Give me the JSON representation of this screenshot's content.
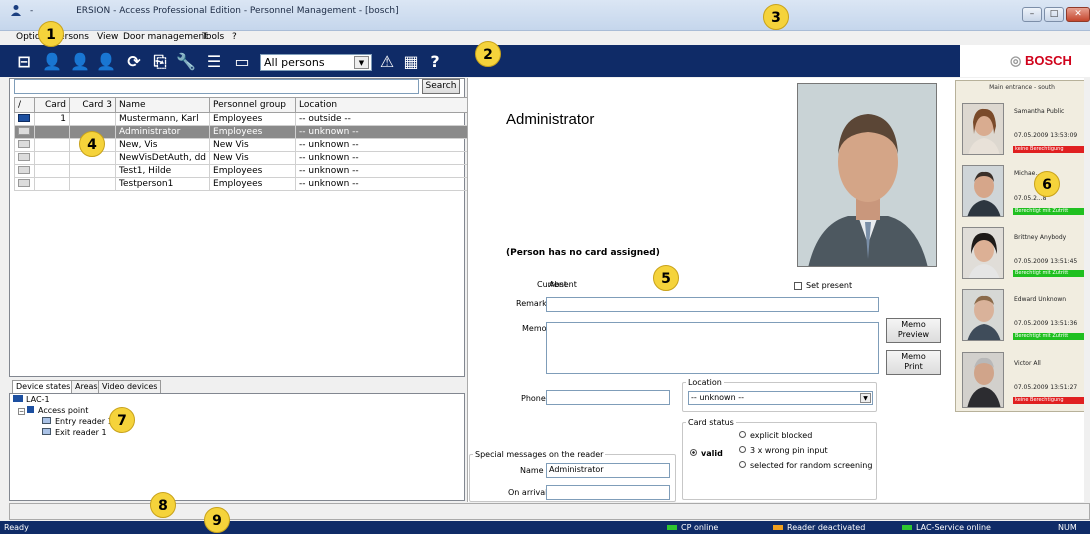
{
  "window": {
    "title": "- ",
    "title_partial": "ERSION - Access Professional Edition - Personnel Management - [bosch]",
    "buttons": {
      "minimize": "–",
      "maximize": "□",
      "close": "✕"
    }
  },
  "menu": {
    "items": [
      "Options",
      "Persons",
      "View",
      "Door management",
      "Tools",
      "?"
    ]
  },
  "toolbar": {
    "icons": [
      "card-reader-icon",
      "add-person-icon",
      "edit-person-icon",
      "delete-person-icon",
      "refresh-icon",
      "export-icon",
      "wrench-icon",
      "database-icon",
      "display-icon"
    ],
    "filter_value": "All persons",
    "right_icons": [
      "warning-icon",
      "grid-icon",
      "help-icon"
    ],
    "brand": "BOSCH"
  },
  "badges": [
    "1",
    "2",
    "3",
    "4",
    "5",
    "6",
    "7",
    "8",
    "9"
  ],
  "search": {
    "value": "",
    "button": "Search"
  },
  "table": {
    "headers": [
      "/",
      "Card",
      "Card 3",
      "Name",
      "Personnel group",
      "Location"
    ],
    "rows": [
      {
        "icon": "card-blue",
        "card": "1",
        "card3": "",
        "name": "Mustermann, Karl",
        "group": "Employees",
        "location": "-- outside --"
      },
      {
        "icon": "card-grey",
        "card": "",
        "card3": "",
        "name": "Administrator",
        "group": "Employees",
        "location": "-- unknown --"
      },
      {
        "icon": "card-grey",
        "card": "",
        "card3": "",
        "name": "New, Vis",
        "group": "New Vis",
        "location": "-- unknown --"
      },
      {
        "icon": "card-grey",
        "card": "",
        "card3": "",
        "name": "NewVisDetAuth, dd",
        "group": "New Vis",
        "location": "-- unknown --"
      },
      {
        "icon": "card-grey",
        "card": "",
        "card3": "",
        "name": "Test1, Hilde",
        "group": "Employees",
        "location": "-- unknown --"
      },
      {
        "icon": "card-grey",
        "card": "",
        "card3": "",
        "name": "Testperson1",
        "group": "Employees",
        "location": "-- unknown --"
      }
    ]
  },
  "lower_tabs": [
    "Device states",
    "Areas",
    "Video devices"
  ],
  "tree": {
    "root": "LAC-1",
    "child": "Access point",
    "leaves": [
      "Entry reader 1",
      "Exit reader 1"
    ]
  },
  "detail": {
    "name": "Administrator",
    "no_card": "(Person has no card assigned)",
    "current_label": "Current",
    "current_value": "Absent",
    "set_present": "Set present",
    "remark_label": "Remark",
    "remark_value": "",
    "memo_label": "Memo",
    "memo_value": "",
    "memo_preview": "Memo\nPreview",
    "memo_print": "Memo\nPrint",
    "phone_label": "Phone",
    "phone_value": "",
    "location_title": "Location",
    "location_value": "-- unknown --",
    "card_status_title": "Card status",
    "card_status_options": [
      "explicit blocked",
      "3 x wrong pin input",
      "selected for random screening"
    ],
    "card_valid": "valid",
    "special_title": "Special messages on the reader",
    "special_name_label": "Name",
    "special_name_value": "Administrator",
    "on_arrival_label": "On arrival",
    "on_arrival_value": ""
  },
  "events": {
    "header": "Main entrance - south",
    "items": [
      {
        "name": "Samantha Public",
        "time": "07.05.2009 13:53:09",
        "status": "keine Berechtigung",
        "status_color": "#e02020"
      },
      {
        "name": "Michae...",
        "time": "07.05.2...8",
        "status": "Berechtigt mit Zutritt",
        "status_color": "#20c020"
      },
      {
        "name": "Brittney Anybody",
        "time": "07.05.2009 13:51:45",
        "status": "Berechtigt mit Zutritt",
        "status_color": "#20c020"
      },
      {
        "name": "Edward Unknown",
        "time": "07.05.2009 13:51:36",
        "status": "Berechtigt mit Zutritt",
        "status_color": "#20c020"
      },
      {
        "name": "Victor All",
        "time": "07.05.2009 13:51:27",
        "status": "keine Berechtigung",
        "status_color": "#e02020"
      }
    ]
  },
  "statusbar": {
    "ready": "Ready",
    "items": [
      {
        "label": "CP online",
        "color": "#2fc62f"
      },
      {
        "label": "Reader deactivated",
        "color": "#f0a020"
      },
      {
        "label": "LAC-Service online",
        "color": "#2fc62f"
      }
    ],
    "num": "NUM"
  }
}
